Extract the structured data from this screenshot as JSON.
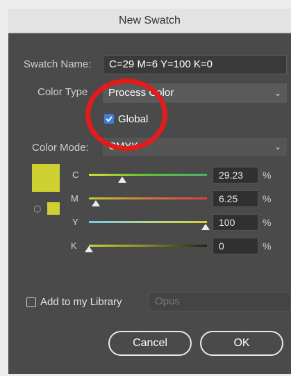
{
  "window": {
    "title": "New Swatch"
  },
  "swatch_name": {
    "label": "Swatch Name:",
    "value": "C=29 M=6 Y=100 K=0"
  },
  "color_type": {
    "label": "Color Type",
    "value": "Process Color"
  },
  "global": {
    "label": "Global",
    "checked": true
  },
  "color_mode": {
    "label": "Color Mode:",
    "value": "CMYK"
  },
  "swatch_color": "#cfd133",
  "sliders": [
    {
      "letter": "C",
      "value": "29.23",
      "unit": "%",
      "level": 0.2923
    },
    {
      "letter": "M",
      "value": "6.25",
      "unit": "%",
      "level": 0.0625
    },
    {
      "letter": "Y",
      "value": "100",
      "unit": "%",
      "level": 1.0
    },
    {
      "letter": "K",
      "value": "0",
      "unit": "%",
      "level": 0.0
    }
  ],
  "library": {
    "label": "Add to my Library",
    "dropdown_value": "Opus",
    "checked": false
  },
  "buttons": {
    "cancel": "Cancel",
    "ok": "OK"
  },
  "colors": {
    "annotation_circle": "#e31b1b",
    "checkbox_blue": "#3d7fd8"
  }
}
